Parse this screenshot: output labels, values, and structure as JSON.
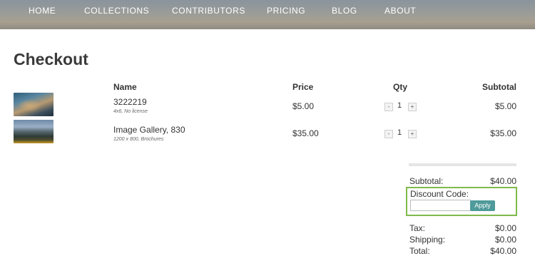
{
  "nav": {
    "items": [
      {
        "label": "HOME"
      },
      {
        "label": "COLLECTIONS"
      },
      {
        "label": "CONTRIBUTORS"
      },
      {
        "label": "PRICING"
      },
      {
        "label": "BLOG"
      },
      {
        "label": "ABOUT"
      }
    ]
  },
  "page": {
    "title": "Checkout"
  },
  "table": {
    "headers": {
      "name": "Name",
      "price": "Price",
      "qty": "Qty",
      "subtotal": "Subtotal"
    },
    "rows": [
      {
        "name": "3222219",
        "meta": "4x6, No license",
        "price": "$5.00",
        "qty": "1",
        "subtotal": "$5.00",
        "minus": "-",
        "plus": "+"
      },
      {
        "name": "Image Gallery, 830",
        "meta": "1200 x 800, Brochures",
        "price": "$35.00",
        "qty": "1",
        "subtotal": "$35.00",
        "minus": "-",
        "plus": "+"
      }
    ]
  },
  "summary": {
    "subtotal_label": "Subtotal:",
    "subtotal_value": "$40.00",
    "discount_label": "Discount Code:",
    "discount_value": "",
    "apply_label": "Apply",
    "tax_label": "Tax:",
    "tax_value": "$0.00",
    "shipping_label": "Shipping:",
    "shipping_value": "$0.00",
    "total_label": "Total:",
    "total_value": "$40.00"
  },
  "colors": {
    "accent_apply": "#4f9a9a",
    "discount_highlight": "#7fba4a"
  }
}
